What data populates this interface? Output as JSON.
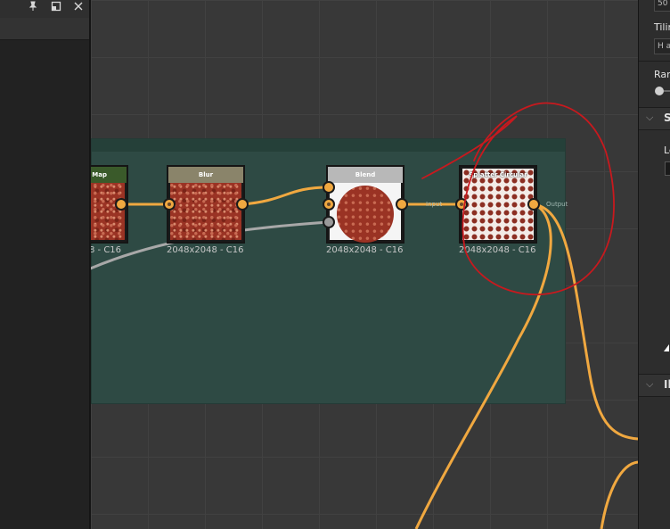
{
  "left_panel": {
    "pin_icon": "pin-icon",
    "float_icon": "float-window-icon",
    "close_icon": "close-icon"
  },
  "graph": {
    "nodes": [
      {
        "title": "Map",
        "size_label": "8 - C16",
        "header_color": "#3a5a2a"
      },
      {
        "title": "Blur",
        "size_label": "2048x2048 - C16",
        "header_color": "#8a846a"
      },
      {
        "title": "Blend",
        "size_label": "2048x2048 - C16",
        "header_color": "#b8b8b8"
      },
      {
        "title": "Splatter Circular",
        "size_label": "2048x2048 - C16",
        "header_color": "#6a6a6a"
      }
    ],
    "port_labels": {
      "input": "Input",
      "output": "Output"
    },
    "colors": {
      "wire_orange": "#f0a840",
      "wire_gray": "#a8a8a8",
      "frame": "#2e4a44",
      "annotation_red": "#c8191e"
    }
  },
  "right_panel": {
    "field_top_value": "50",
    "tiling_label": "Tilin",
    "tiling_value": "H a",
    "random_label": "Ran",
    "section_s_title": "S",
    "le_label": "Le",
    "section_i_title": "Il"
  }
}
